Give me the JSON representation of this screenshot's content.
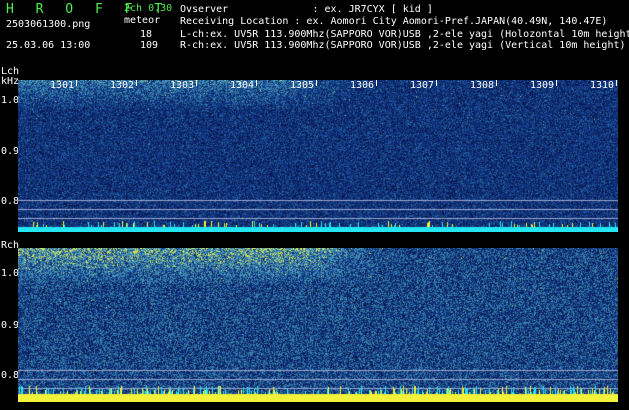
{
  "header": {
    "app_title": "H R O F F T",
    "mode": "2ch 0.30",
    "filename": "2503061300.png",
    "datetime": "25.03.06 13:00",
    "meteor_label": "meteor",
    "count_l": "18",
    "count_r": "109",
    "observer": "Ovserver              : ex. JR7CYX [ kid ]",
    "location": "Receiving Location : ex. Aomori City Aomori-Pref.JAPAN(40.49N, 140.47E)",
    "lch_info": "L-ch:ex. UV5R 113.900Mhz(SAPPORO VOR)USB ,2-ele yagi (Holozontal 10m height)",
    "rch_info": "R-ch:ex. UV5R 113.900Mhz(SAPPORO VOR)USB ,2-ele yagi (Vertical 10m height)"
  },
  "lch": {
    "label": "Lch",
    "unit": "kHz",
    "y_ticks": [
      "1.0",
      "0.9",
      "0.8"
    ]
  },
  "rch": {
    "label": "Rch",
    "y_ticks": [
      "1.0",
      "0.9",
      "0.8"
    ]
  },
  "time_ticks": [
    "1301",
    "1302",
    "1303",
    "1304",
    "1305",
    "1306",
    "1307",
    "1308",
    "1309",
    "1310"
  ],
  "colors": {
    "header_green": "#4cf04c",
    "spectrum_low": "#0a1e78",
    "spectrum_mid": "#2f8fd8",
    "spectrum_high": "#dfe84a",
    "baseline_cyan": "#22e6f2",
    "baseline_yellow": "#f2f23a"
  }
}
